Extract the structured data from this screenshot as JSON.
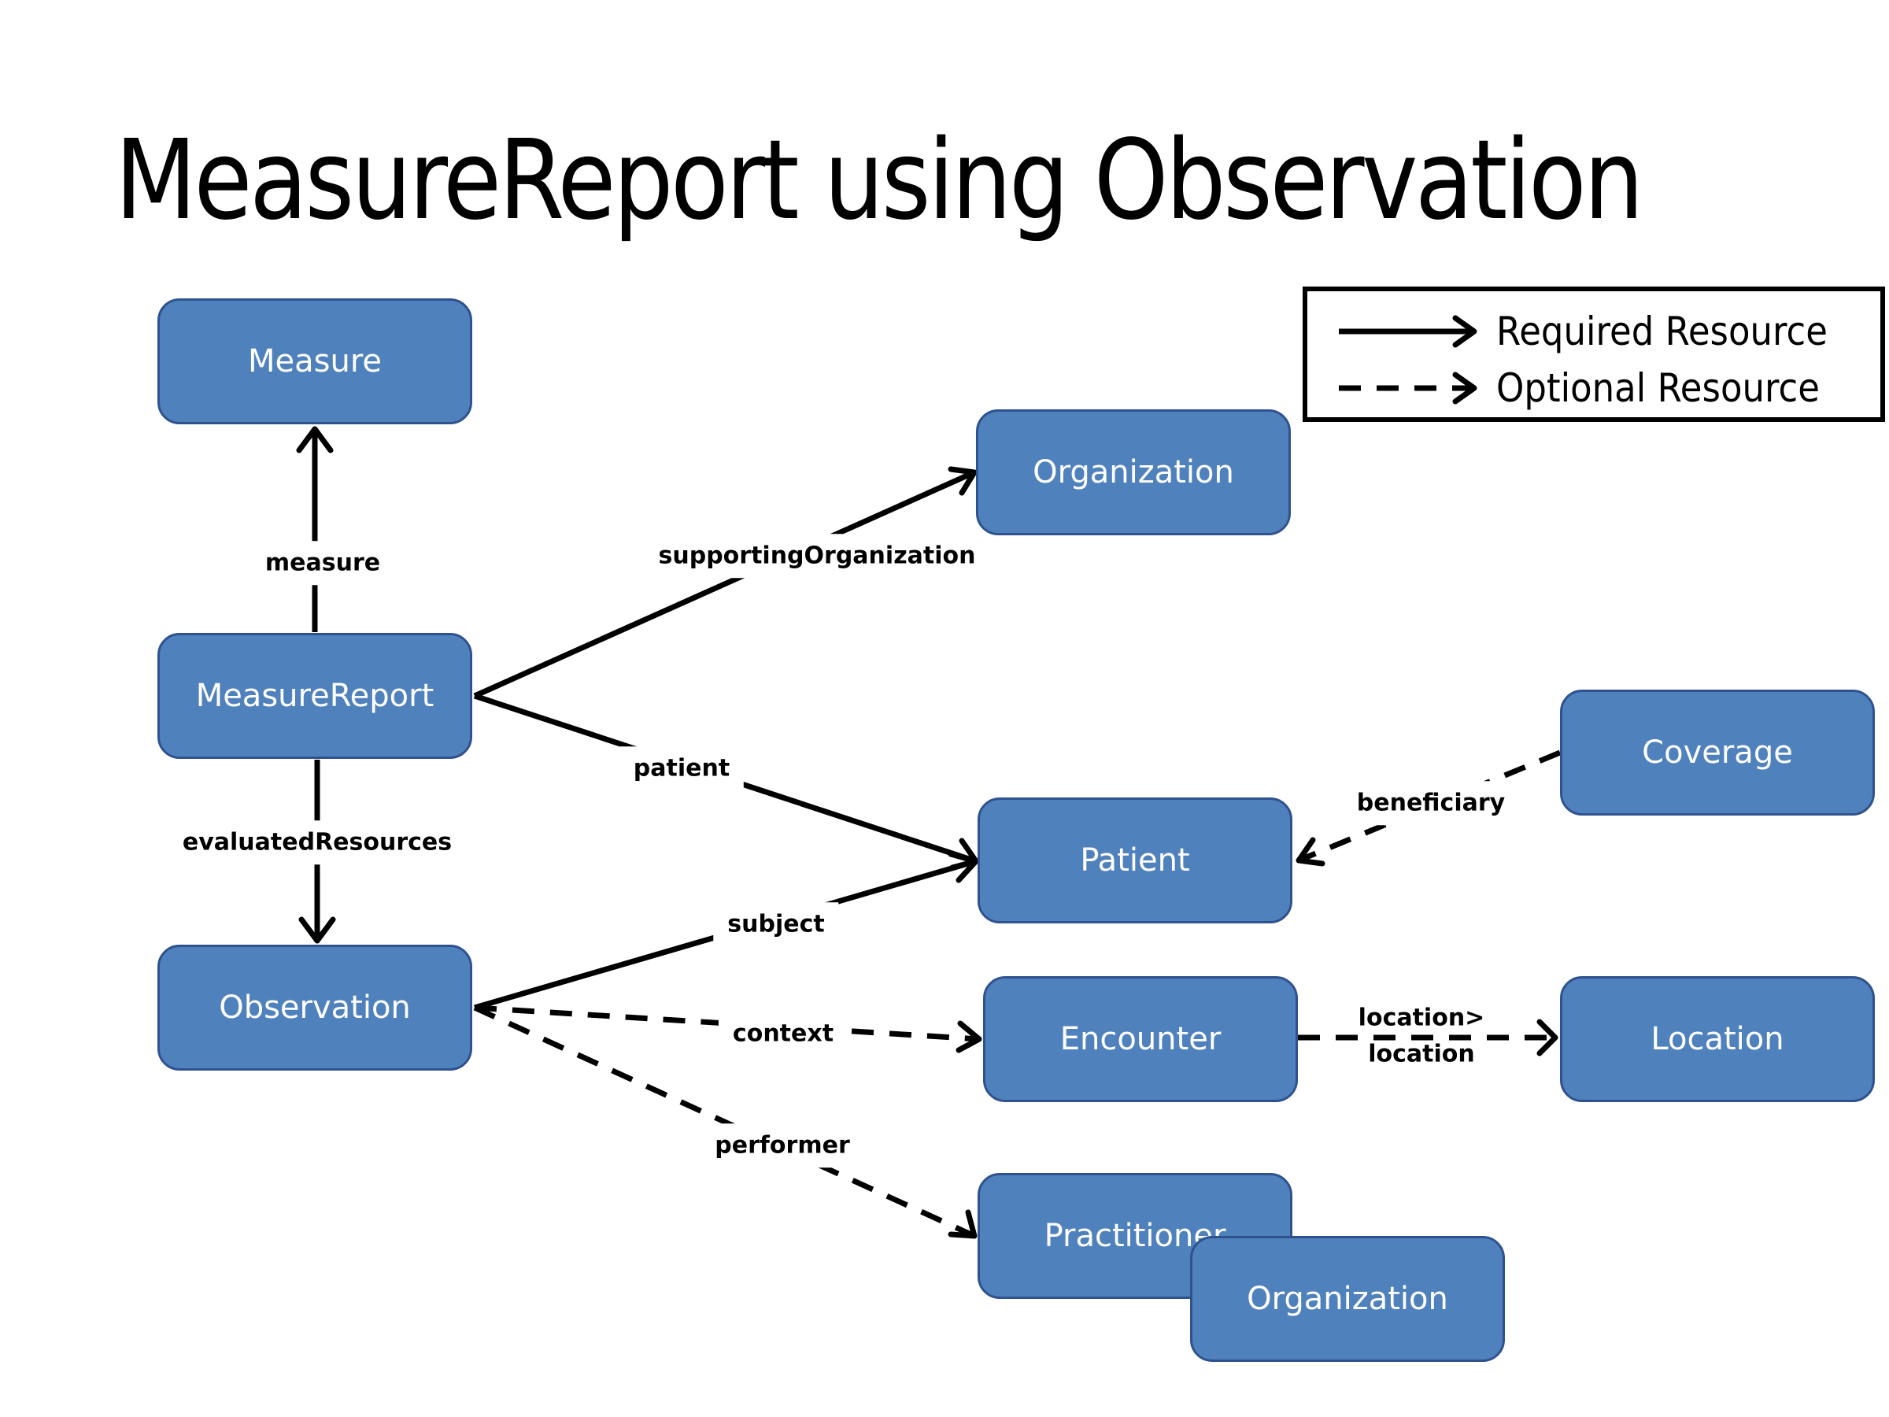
{
  "title": "MeasureReport using Observation",
  "legend": {
    "required_label": "Required Resource",
    "optional_label": "Optional Resource"
  },
  "colors": {
    "node_fill": "#4F81BD",
    "node_border": "#2F528F",
    "edge": "#000000",
    "node_text": "#FFFFFF"
  },
  "nodes": [
    {
      "id": "measure",
      "label": "Measure"
    },
    {
      "id": "measurereport",
      "label": "MeasureReport"
    },
    {
      "id": "observation",
      "label": "Observation"
    },
    {
      "id": "organization-supporting",
      "label": "Organization"
    },
    {
      "id": "patient",
      "label": "Patient"
    },
    {
      "id": "coverage",
      "label": "Coverage"
    },
    {
      "id": "encounter",
      "label": "Encounter"
    },
    {
      "id": "location",
      "label": "Location"
    },
    {
      "id": "practitioner",
      "label": "Practitioner"
    },
    {
      "id": "organization-performer",
      "label": "Organization"
    }
  ],
  "edges": [
    {
      "from": "measurereport",
      "to": "measure",
      "label": "measure",
      "style": "required"
    },
    {
      "from": "measurereport",
      "to": "observation",
      "label": "evaluatedResources",
      "style": "required"
    },
    {
      "from": "measurereport",
      "to": "organization-supporting",
      "label": "supportingOrganization",
      "style": "required"
    },
    {
      "from": "measurereport",
      "to": "patient",
      "label": "patient",
      "style": "required"
    },
    {
      "from": "observation",
      "to": "patient",
      "label": "subject",
      "style": "required"
    },
    {
      "from": "coverage",
      "to": "patient",
      "label": "beneficiary",
      "style": "optional"
    },
    {
      "from": "observation",
      "to": "encounter",
      "label": "context",
      "style": "optional"
    },
    {
      "from": "encounter",
      "to": "location",
      "label": "location>\nlocation",
      "label_line1": "location>",
      "label_line2": "location",
      "style": "optional"
    },
    {
      "from": "observation",
      "to": "practitioner",
      "label": "performer",
      "style": "optional"
    }
  ]
}
